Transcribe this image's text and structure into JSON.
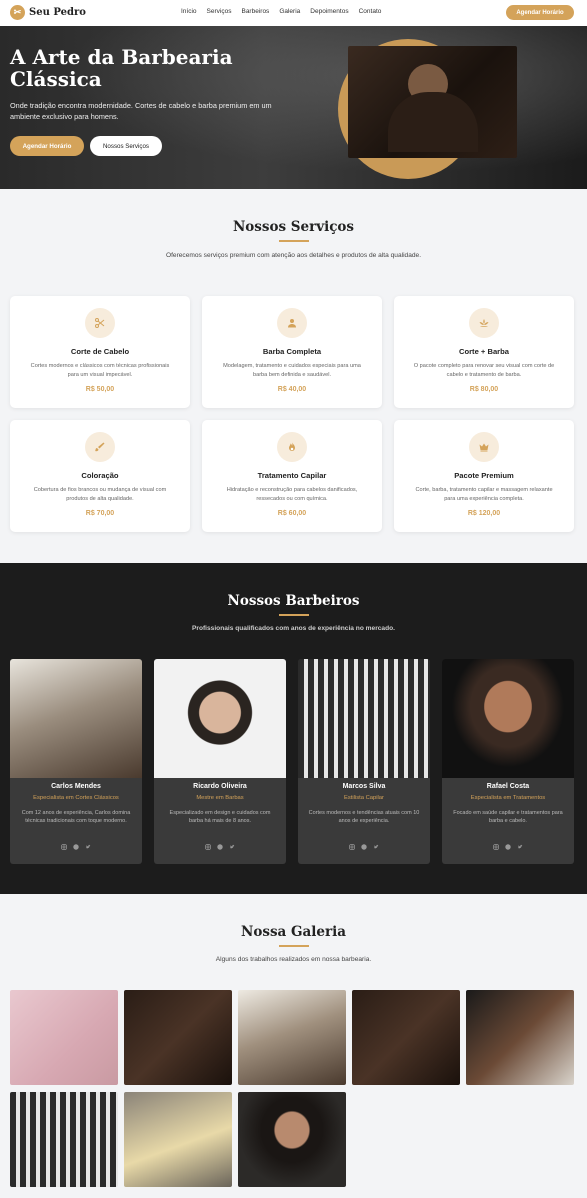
{
  "nav": {
    "logo_text": "Seu Pedro",
    "links": [
      "Início",
      "Serviços",
      "Barbeiros",
      "Galeria",
      "Depoimentos",
      "Contato"
    ],
    "cta": "Agendar Horário"
  },
  "hero": {
    "title": "A Arte da Barbearia Clássica",
    "subtitle": "Onde tradição encontra modernidade. Cortes de cabelo e barba premium em um ambiente exclusivo para homens.",
    "primary_button": "Agendar Horário",
    "secondary_button": "Nossos Serviços"
  },
  "services": {
    "title": "Nossos Serviços",
    "description": "Oferecemos serviços premium com atenção aos detalhes e produtos de alta qualidade.",
    "items": [
      {
        "icon": "scissors-icon",
        "name": "Corte de Cabelo",
        "desc": "Cortes modernos e clássicos com técnicas profissionais para um visual impecável.",
        "price": "R$ 50,00"
      },
      {
        "icon": "user-icon",
        "name": "Barba Completa",
        "desc": "Modelagem, tratamento e cuidados especiais para uma barba bem definida e saudável.",
        "price": "R$ 40,00"
      },
      {
        "icon": "spa-icon",
        "name": "Corte + Barba",
        "desc": "O pacote completo para renovar seu visual com corte de cabelo e tratamento de barba.",
        "price": "R$ 80,00"
      },
      {
        "icon": "brush-icon",
        "name": "Coloração",
        "desc": "Cobertura de fios brancos ou mudança de visual com produtos de alta qualidade.",
        "price": "R$ 70,00"
      },
      {
        "icon": "flame-icon",
        "name": "Tratamento Capilar",
        "desc": "Hidratação e reconstrução para cabelos danificados, ressecados ou com química.",
        "price": "R$ 60,00"
      },
      {
        "icon": "crown-icon",
        "name": "Pacote Premium",
        "desc": "Corte, barba, tratamento capilar e massagem relaxante para uma experiência completa.",
        "price": "R$ 120,00"
      }
    ]
  },
  "barbers": {
    "title": "Nossos Barbeiros",
    "description": "Profissionais qualificados com anos de experiência no mercado.",
    "items": [
      {
        "name": "Carlos Mendes",
        "role": "Especialista em Cortes Clássicos",
        "desc": "Com 12 anos de experiência, Carlos domina técnicas tradicionais com toque moderno."
      },
      {
        "name": "Ricardo Oliveira",
        "role": "Mestre em Barbas",
        "desc": "Especializado em design e cuidados com barba há mais de 8 anos."
      },
      {
        "name": "Marcos Silva",
        "role": "Estilista Capilar",
        "desc": "Cortes modernos e tendências atuais com 10 anos de experiência."
      },
      {
        "name": "Rafael Costa",
        "role": "Especialista em Tratamentos",
        "desc": "Focado em saúde capilar e tratamentos para barba e cabelo."
      }
    ]
  },
  "gallery": {
    "title": "Nossa Galeria",
    "description": "Alguns dos trabalhos realizados em nossa barbearia."
  },
  "colors": {
    "accent": "#d4a35a",
    "dark": "#1c1c1c"
  }
}
